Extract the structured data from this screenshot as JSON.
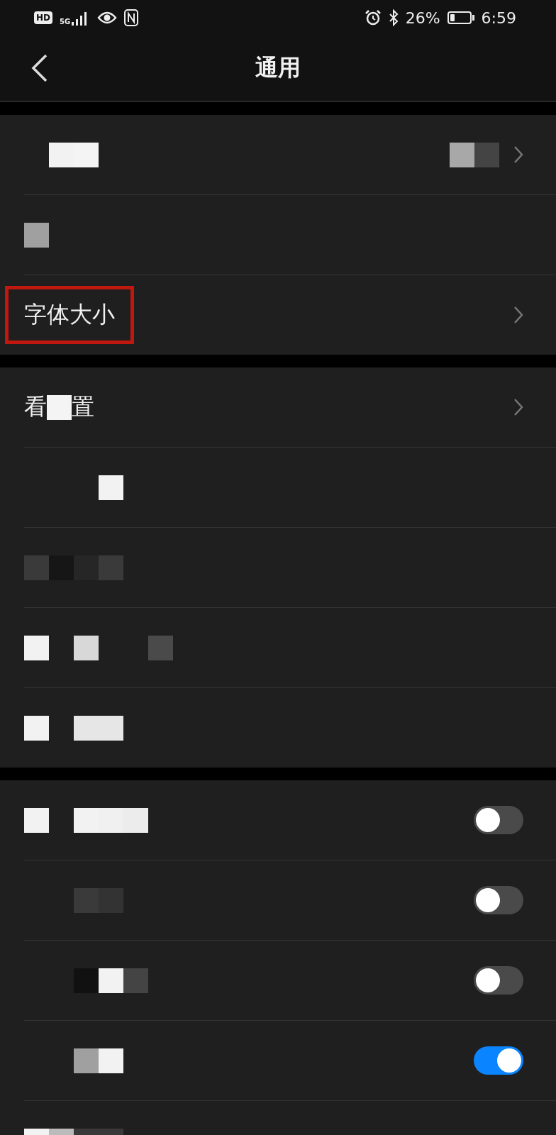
{
  "status_bar": {
    "hd_badge": "HD",
    "network": "5G",
    "battery_text": "26%",
    "battery": {
      "level": 0.26
    },
    "time": "6:59"
  },
  "header": {
    "title": "通用"
  },
  "groups": [
    {
      "rows": [
        {
          "kind": "mosaic",
          "chevron": true,
          "value_hidden": true
        },
        {
          "kind": "mosaic"
        },
        {
          "kind": "text",
          "label": "字体大小",
          "chevron": true,
          "highlighted": true
        }
      ]
    },
    {
      "rows": [
        {
          "kind": "partial",
          "parts": [
            "看",
            "置"
          ],
          "chevron": true
        },
        {
          "kind": "mosaic"
        },
        {
          "kind": "mosaic"
        },
        {
          "kind": "mosaic"
        },
        {
          "kind": "mosaic"
        }
      ]
    },
    {
      "rows": [
        {
          "kind": "mosaic",
          "toggle": {
            "on": false
          }
        },
        {
          "kind": "mosaic",
          "toggle": {
            "on": false
          }
        },
        {
          "kind": "mosaic",
          "toggle": {
            "on": false
          }
        },
        {
          "kind": "mosaic",
          "toggle": {
            "on": true
          }
        },
        {
          "kind": "mosaic"
        }
      ]
    }
  ]
}
